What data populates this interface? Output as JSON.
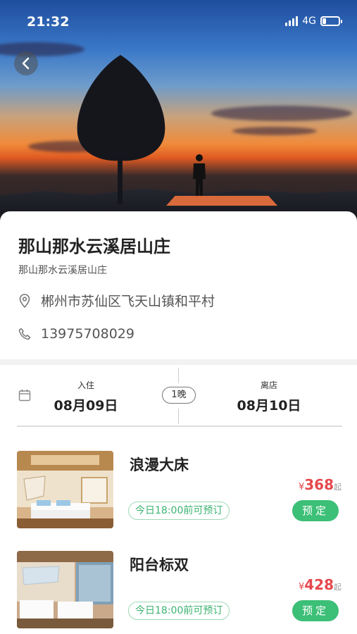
{
  "status_bar": {
    "time": "21:32",
    "network": "4G"
  },
  "hotel": {
    "name": "那山那水云溪居山庄",
    "subtitle": "那山那水云溪居山庄",
    "address": "郴州市苏仙区飞天山镇和平村",
    "phone": "13975708029"
  },
  "dates": {
    "checkin_label": "入住",
    "checkin_value": "08月09日",
    "nights": "1晚",
    "checkout_label": "离店",
    "checkout_value": "08月10日"
  },
  "rooms": [
    {
      "name": "浪漫大床",
      "availability": "今日18:00前可预订",
      "currency": "¥",
      "price": "368",
      "price_suffix": "起",
      "button": "预定"
    },
    {
      "name": "阳台标双",
      "availability": "今日18:00前可预订",
      "currency": "¥",
      "price": "428",
      "price_suffix": "起",
      "button": "预定"
    }
  ],
  "icons": {
    "back": "chevron-left-icon",
    "location": "location-pin-icon",
    "phone": "phone-icon",
    "calendar": "calendar-icon"
  },
  "colors": {
    "accent_green": "#3cbf77",
    "price_red": "#e5484d"
  }
}
